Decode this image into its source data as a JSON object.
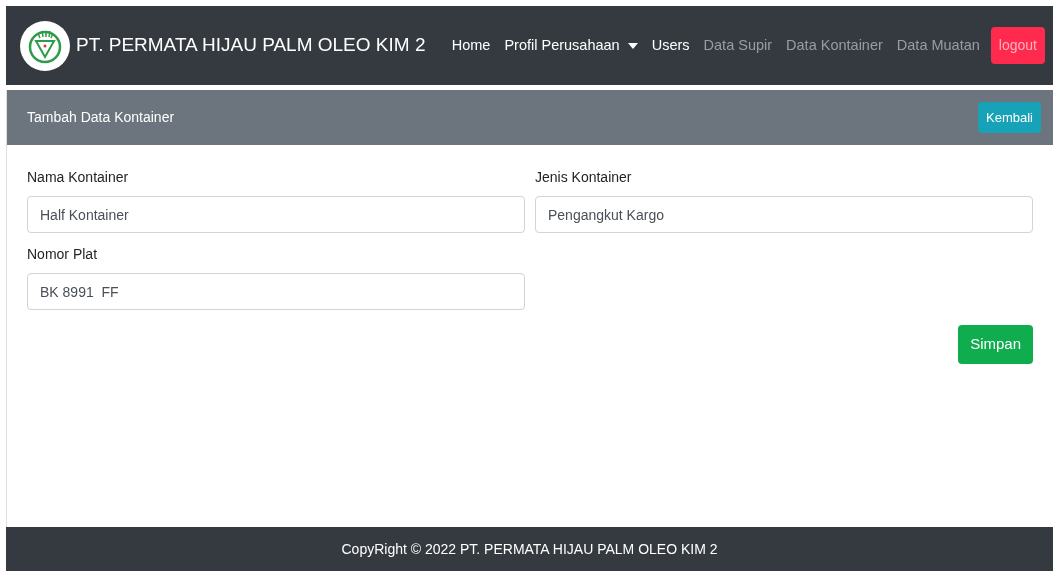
{
  "navbar": {
    "brand": "PT. PERMATA HIJAU PALM OLEO KIM 2",
    "items": [
      {
        "label": "Home",
        "kind": "link",
        "active": true
      },
      {
        "label": "Profil Perusahaan",
        "kind": "dropdown",
        "active": true
      },
      {
        "label": "Users",
        "kind": "link",
        "active": true
      },
      {
        "label": "Data Supir",
        "kind": "link",
        "active": false
      },
      {
        "label": "Data Kontainer",
        "kind": "link",
        "active": false
      },
      {
        "label": "Data Muatan",
        "kind": "link",
        "active": false
      },
      {
        "label": "logout",
        "kind": "button",
        "active": false
      }
    ]
  },
  "card": {
    "title": "Tambah Data Kontainer",
    "back_button": "Kembali"
  },
  "form": {
    "fields": [
      {
        "label": "Nama Kontainer",
        "value": "Half Kontainer"
      },
      {
        "label": "Jenis Kontainer",
        "value": "Pengangkut Kargo"
      },
      {
        "label": "Nomor Plat",
        "value": "BK 8991  FF"
      }
    ],
    "submit": "Simpan"
  },
  "footer": "CopyRight © 2022 PT. PERMATA HIJAU PALM OLEO KIM 2"
}
